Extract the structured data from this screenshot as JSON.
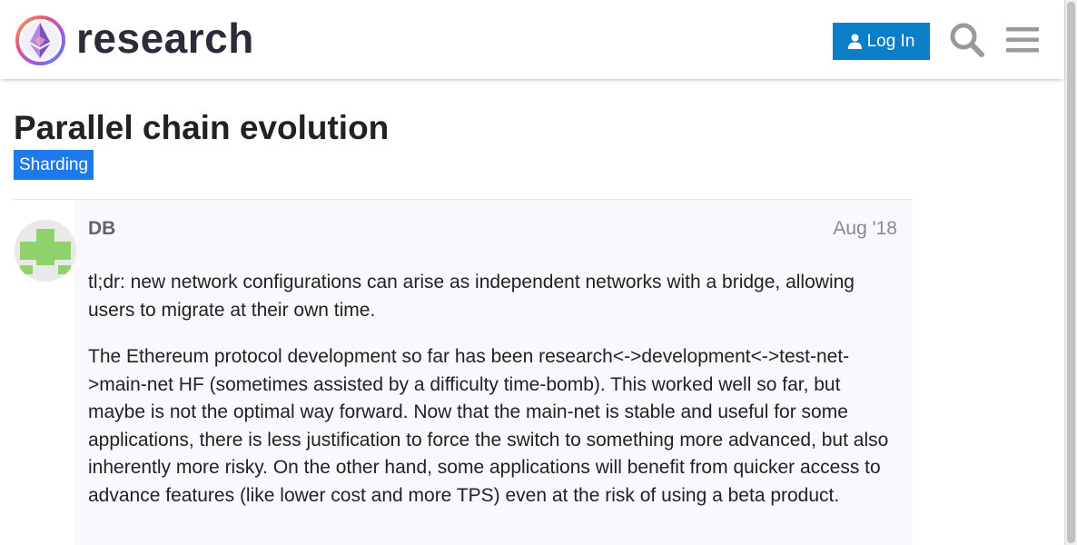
{
  "header": {
    "logo_text": "research",
    "login_label": "Log In",
    "icons": [
      "user-icon",
      "search-icon",
      "hamburger-menu-icon"
    ]
  },
  "topic": {
    "title": "Parallel chain evolution",
    "category": "Sharding"
  },
  "post": {
    "username": "DB",
    "date": "Aug '18",
    "paragraphs": [
      "tl;dr: new network configurations can arise as independent networks with a bridge, allowing users to migrate at their own time.",
      "The Ethereum protocol development so far has been research<->development<->test-net->main-net HF (sometimes assisted by a difficulty time-bomb). This worked well so far, but maybe is not the optimal way forward. Now that the main-net is stable and useful for some applications, there is less justification to force the switch to something more advanced, but also inherently more risky. On the other hand, some applications will benefit from quicker access to advance features (like lower cost and more TPS) even at the risk of using a beta product."
    ]
  },
  "colors": {
    "accent": "#0a7fc7",
    "category": "#1e7ae8",
    "avatar": "#8fd16b"
  }
}
